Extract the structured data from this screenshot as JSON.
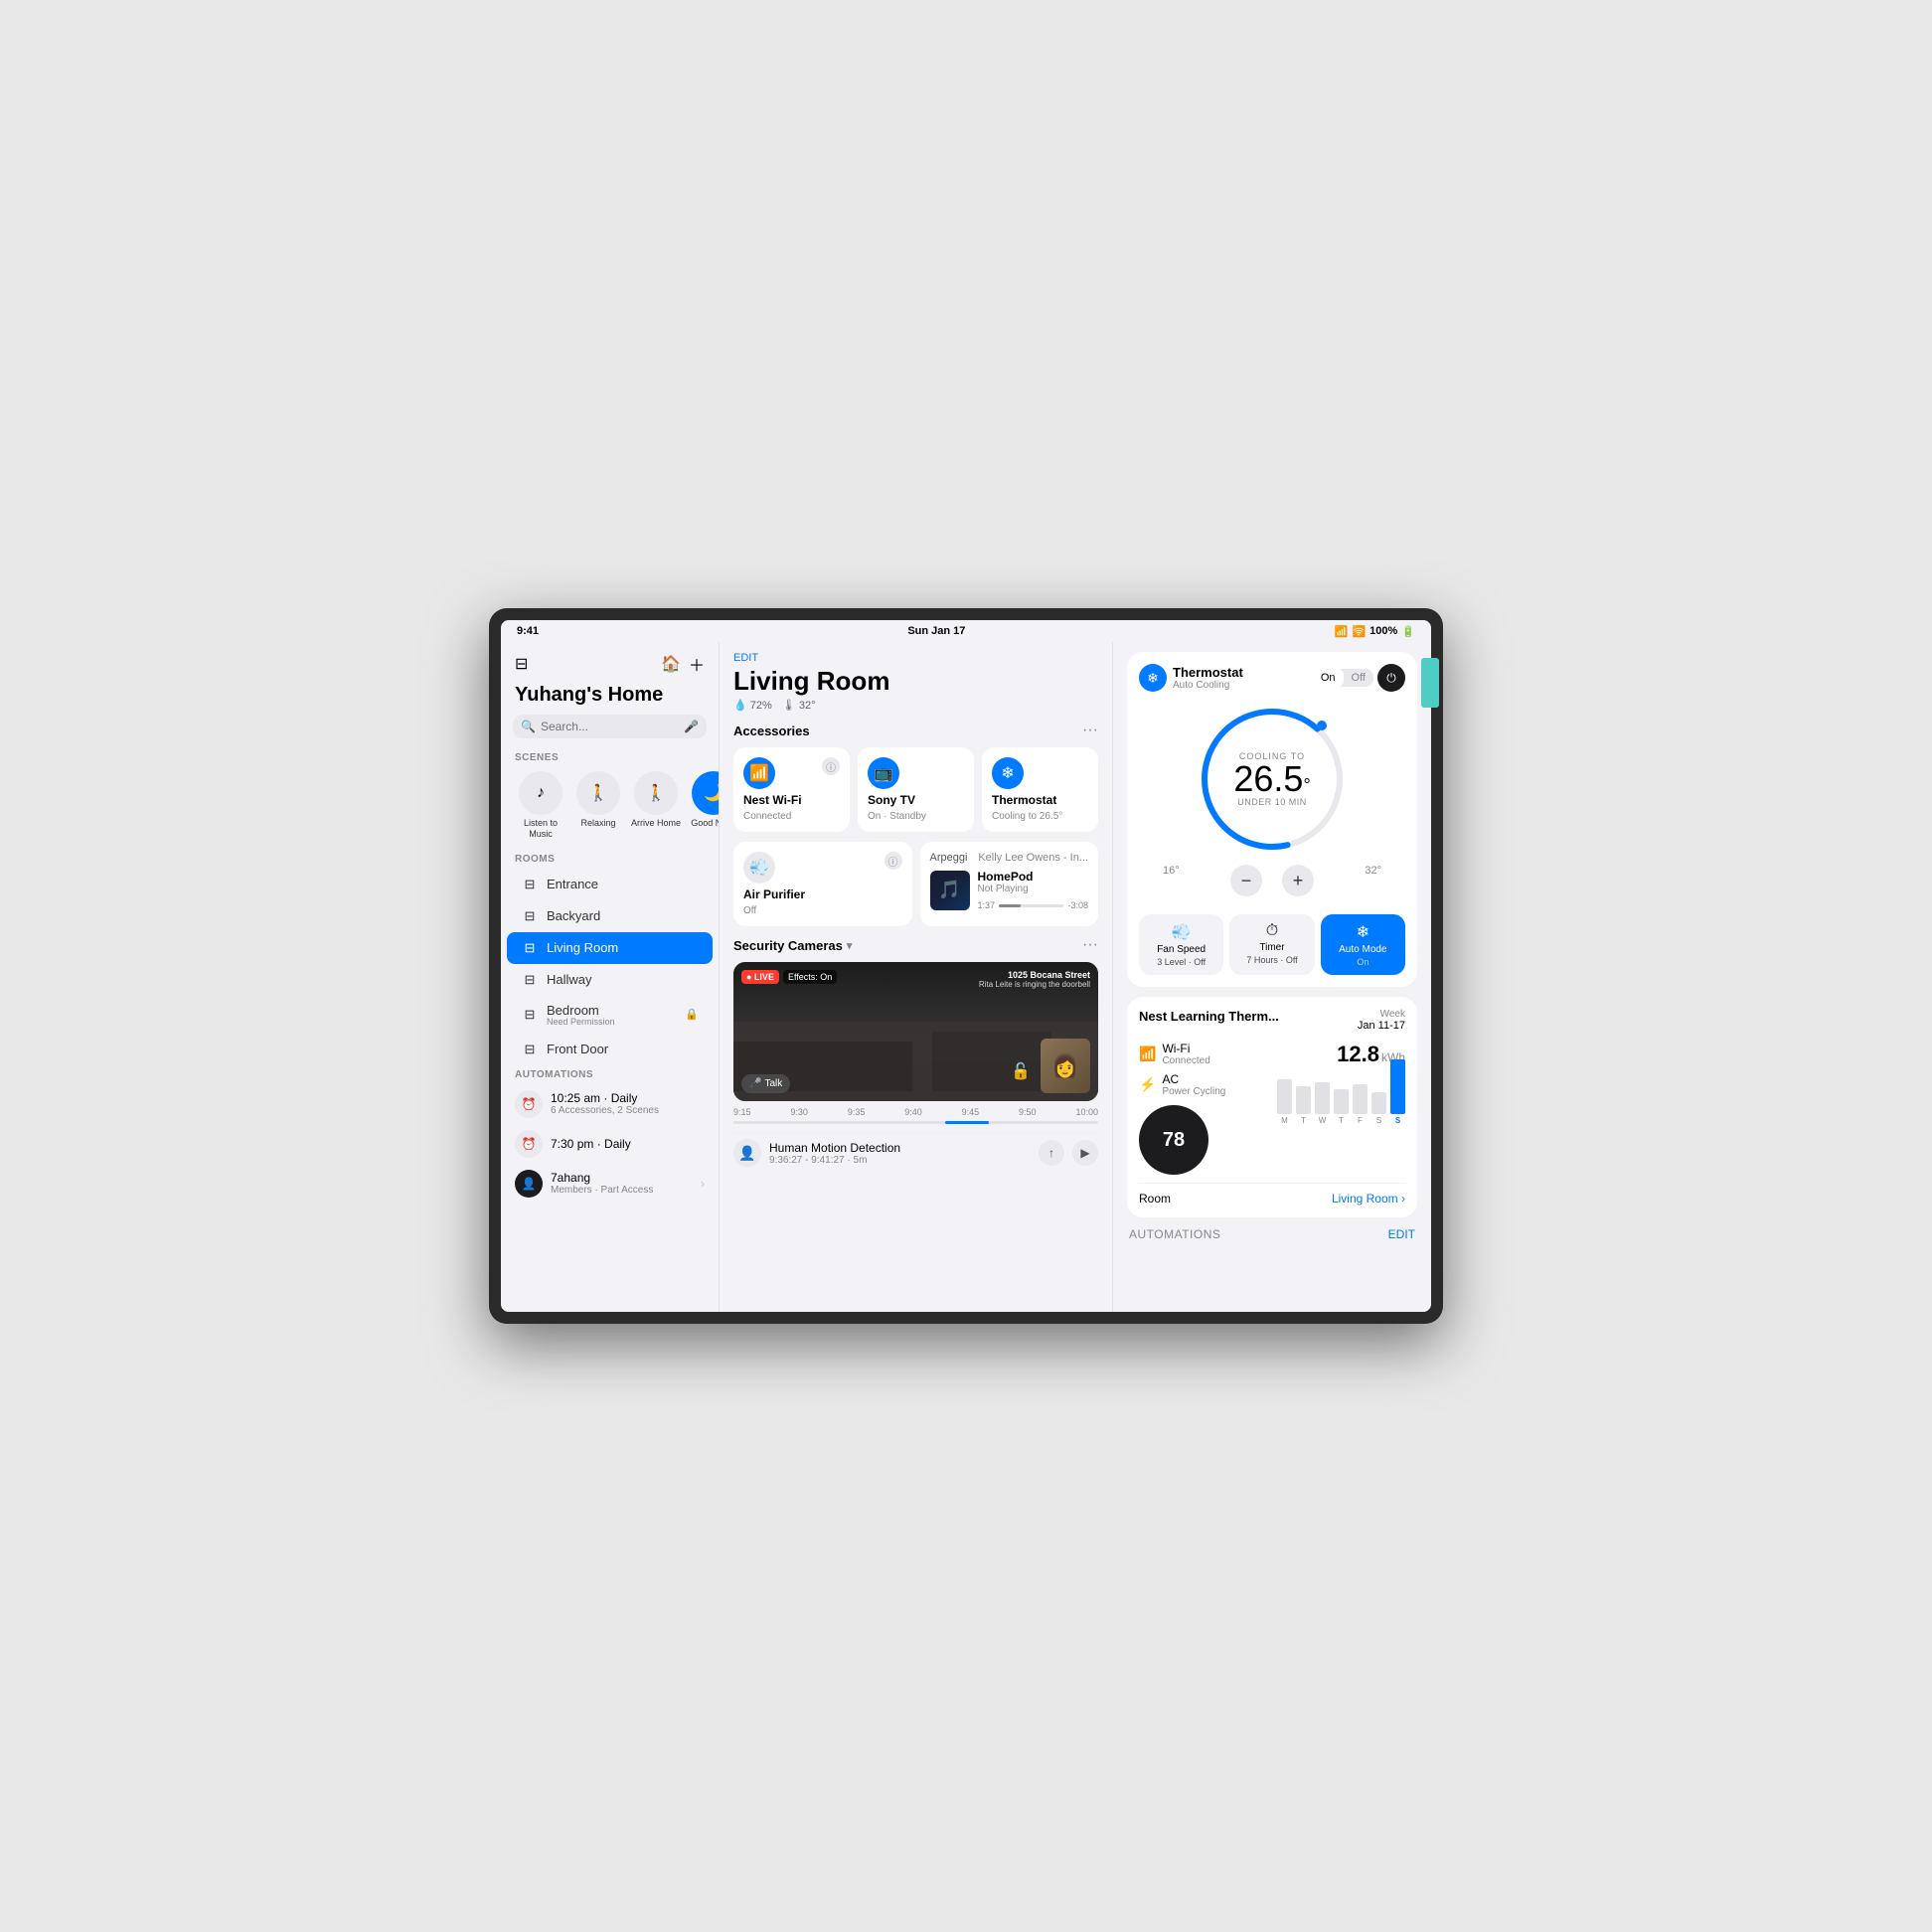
{
  "statusBar": {
    "time": "9:41",
    "date": "Sun Jan 17",
    "battery": "100%",
    "signal": "●●●●"
  },
  "sidebar": {
    "homeTitle": "Yuhang's Home",
    "searchPlaceholder": "Search...",
    "scenesLabel": "SCENES",
    "scenes": [
      {
        "id": "listen",
        "label": "Listen to Music",
        "icon": "♪",
        "active": false
      },
      {
        "id": "relaxing",
        "label": "Relaxing",
        "icon": "🚶",
        "active": false
      },
      {
        "id": "arrive-home",
        "label": "Arrive Home",
        "icon": "🚶",
        "active": false
      },
      {
        "id": "good-night",
        "label": "Good Night",
        "icon": "🌙",
        "active": true
      }
    ],
    "roomsLabel": "ROOMS",
    "rooms": [
      {
        "id": "entrance",
        "label": "Entrance",
        "active": false,
        "locked": false,
        "needPermission": false
      },
      {
        "id": "backyard",
        "label": "Backyard",
        "active": false,
        "locked": false,
        "needPermission": false
      },
      {
        "id": "living-room",
        "label": "Living Room",
        "active": true,
        "locked": false,
        "needPermission": false
      },
      {
        "id": "hallway",
        "label": "Hallway",
        "active": false,
        "locked": false,
        "needPermission": false
      },
      {
        "id": "bedroom",
        "label": "Bedroom",
        "active": false,
        "locked": true,
        "needPermission": true,
        "permissionText": "Need Permission"
      },
      {
        "id": "front-door",
        "label": "Front Door",
        "active": false,
        "locked": false,
        "needPermission": false
      }
    ],
    "automationsLabel": "AUTOMATIONS",
    "automations": [
      {
        "id": "morning",
        "icon": "⏰",
        "title": "10:25 am · Daily",
        "sub": "6 Accessories, 2 Scenes",
        "dark": false
      },
      {
        "id": "evening",
        "icon": "⏰",
        "title": "7:30 pm · Daily",
        "sub": "",
        "dark": false
      },
      {
        "id": "7ahang",
        "icon": "👤",
        "title": "7ahang",
        "sub": "Members · Part Access",
        "dark": true,
        "hasArrow": true
      }
    ]
  },
  "middlePanel": {
    "editLabel": "EDIT",
    "roomTitle": "Living Room",
    "humidity": "72%",
    "temperature": "32°",
    "accessoriesLabel": "Accessories",
    "accessories": [
      {
        "id": "nest-wifi",
        "name": "Nest Wi-Fi",
        "status": "Connected",
        "icon": "📶",
        "iconType": "blue"
      },
      {
        "id": "sony-tv",
        "name": "Sony TV",
        "status": "On · Standby",
        "icon": "📺",
        "iconType": "blue"
      },
      {
        "id": "thermostat",
        "name": "Thermostat",
        "status": "Cooling to 26.5°",
        "icon": "❄",
        "iconType": "blue"
      }
    ],
    "accessories2": [
      {
        "id": "air-purifier",
        "name": "Air Purifier",
        "status": "Off",
        "icon": "💨",
        "iconType": "gray"
      },
      {
        "id": "homepod",
        "name": "HomePod",
        "status": "Not Playing",
        "isPlayer": true
      }
    ],
    "player": {
      "song": "Arpeggi",
      "artist": "Kelly Lee Owens - In...",
      "progress": "1:37",
      "duration": "-3:08",
      "progressPct": 33
    },
    "securityLabel": "Security Cameras",
    "camera": {
      "address": "1025 Bocana Street",
      "doorbellText": "Rita Leite is ringing the doorbell",
      "isLive": true,
      "effects": "Effects: On"
    },
    "timeline": {
      "times": [
        "9:15",
        "9:30",
        "9:35",
        "9:40",
        "9:45",
        "9:50",
        "10:00"
      ],
      "highlightStart": 58,
      "highlightWidth": 12
    },
    "event": {
      "title": "Human Motion Detection",
      "time": "9:36:27 - 9:41:27 · 5m"
    }
  },
  "rightPanel": {
    "thermostat": {
      "name": "Thermostat",
      "sub": "Auto Cooling",
      "onLabel": "On",
      "offLabel": "Off",
      "coolingLabel": "COOLING TO",
      "temp": "26.5",
      "unit": "°",
      "sublabel": "UNDER 10 MIN",
      "minTemp": "16°",
      "maxTemp": "32°",
      "controls": [
        {
          "id": "fan-speed",
          "icon": "💨",
          "label": "Fan Speed",
          "sub": "3 Level · Off",
          "active": false
        },
        {
          "id": "timer",
          "icon": "⏱",
          "label": "Timer",
          "sub": "7 Hours · Off",
          "active": false
        },
        {
          "id": "auto-mode",
          "icon": "❄",
          "label": "Auto Mode",
          "sub": "On",
          "active": true
        }
      ]
    },
    "nest": {
      "title": "Nest Learning Therm...",
      "period": "Week",
      "dateRange": "Jan 11-17",
      "wifi": {
        "label": "Wi-Fi",
        "sub": "Connected"
      },
      "ac": {
        "label": "AC",
        "sub": "Power Cycling"
      },
      "deviceTemp": "78",
      "kwh": "12.8",
      "kwhUnit": "kWh",
      "bars": [
        {
          "day": "M",
          "height": 35,
          "highlight": false
        },
        {
          "day": "T",
          "height": 28,
          "highlight": false
        },
        {
          "day": "W",
          "height": 32,
          "highlight": false
        },
        {
          "day": "T",
          "height": 25,
          "highlight": false
        },
        {
          "day": "F",
          "height": 30,
          "highlight": false
        },
        {
          "day": "S",
          "height": 22,
          "highlight": false
        },
        {
          "day": "S",
          "height": 55,
          "highlight": true
        }
      ],
      "roomLabel": "Room",
      "roomValue": "Living Room",
      "automationsLabel": "AUTOMATIONS",
      "editLabel": "EDIT"
    }
  }
}
